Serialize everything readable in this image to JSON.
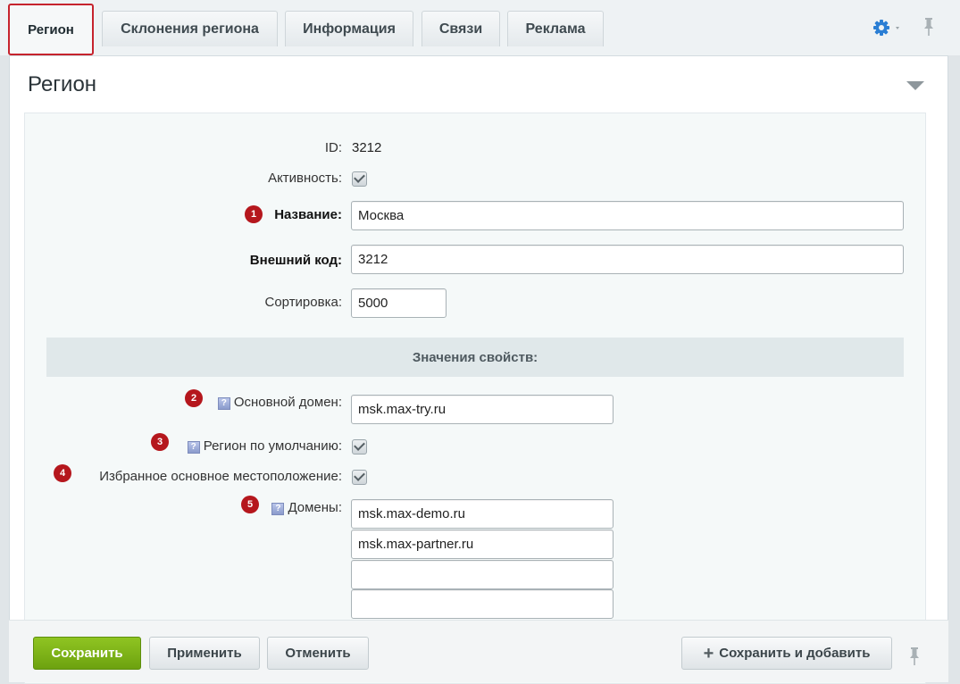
{
  "tabs": [
    {
      "label": "Регион",
      "active": true
    },
    {
      "label": "Склонения региона"
    },
    {
      "label": "Информация"
    },
    {
      "label": "Связи"
    },
    {
      "label": "Реклама"
    }
  ],
  "panel": {
    "title": "Регион"
  },
  "fields": {
    "id": {
      "label": "ID:",
      "value": "3212"
    },
    "active": {
      "label": "Активность:",
      "checked": true
    },
    "name": {
      "label": "Название:",
      "value": "Москва",
      "badge": "1"
    },
    "external_code": {
      "label": "Внешний код:",
      "value": "3212"
    },
    "sort": {
      "label": "Сортировка:",
      "value": "5000"
    }
  },
  "properties": {
    "header": "Значения свойств:",
    "main_domain": {
      "label": "Основной домен:",
      "value": "msk.max-try.ru",
      "badge": "2"
    },
    "default_region": {
      "label": "Регион по умолчанию:",
      "checked": true,
      "badge": "3"
    },
    "favorite_location": {
      "label": "Избранное основное местоположение:",
      "checked": true,
      "badge": "4"
    },
    "domains": {
      "label": "Домены:",
      "badge": "5",
      "values": [
        "msk.max-demo.ru",
        "msk.max-partner.ru",
        "",
        ""
      ]
    }
  },
  "help_glyph": "?",
  "footer": {
    "save": "Сохранить",
    "apply": "Применить",
    "cancel": "Отменить",
    "save_add": "Сохранить и добавить",
    "plus_glyph": "+"
  },
  "colors": {
    "accent_green": "#7cb518",
    "badge_red": "#b5171d",
    "active_tab_border": "#c6232d"
  },
  "icons": {
    "settings": "gear-icon",
    "pin": "pin-icon",
    "collapse": "triangle-down-icon"
  }
}
